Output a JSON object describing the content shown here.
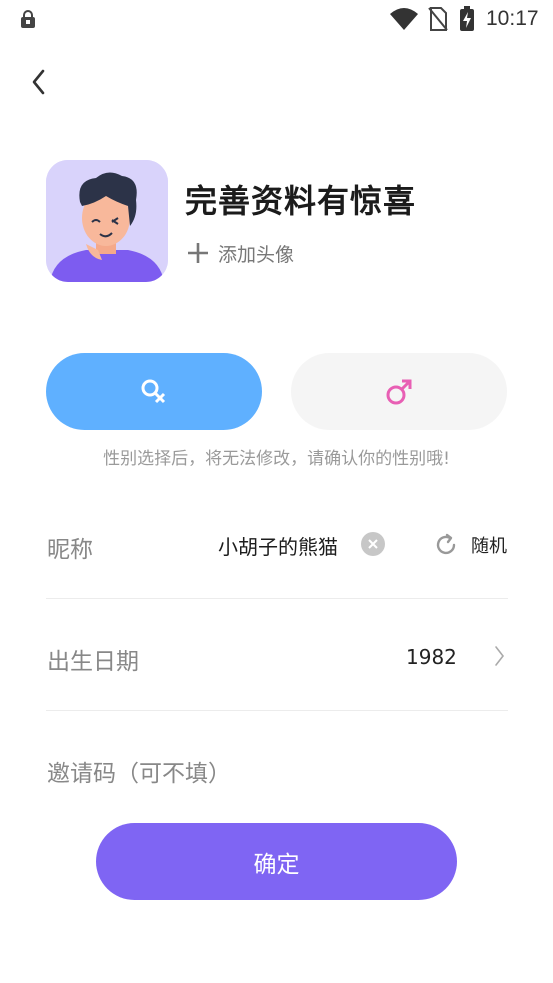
{
  "status_bar": {
    "time": "10:17",
    "icons": [
      "lock-icon",
      "wifi-icon",
      "no-sim-icon",
      "battery-charging-icon"
    ]
  },
  "nav": {
    "back_icon": "chevron-left-icon"
  },
  "profile": {
    "title": "完善资料有惊喜",
    "add_avatar_label": "添加头像",
    "add_avatar_icon": "plus-icon"
  },
  "gender": {
    "female_icon": "female-symbol-icon",
    "male_icon": "male-symbol-icon",
    "selected": "female",
    "hint": "性别选择后，将无法修改，请确认你的性别哦!"
  },
  "form": {
    "nickname": {
      "label": "昵称",
      "value": "小胡子的熊猫",
      "clear_icon": "clear-icon",
      "random_icon": "refresh-icon",
      "random_label": "随机"
    },
    "birthday": {
      "label": "出生日期",
      "value": "1982",
      "chevron_icon": "chevron-right-icon"
    },
    "invite_code": {
      "placeholder": "邀请码（可不填）"
    }
  },
  "actions": {
    "confirm_label": "确定"
  },
  "colors": {
    "accent_purple": "#7f65f3",
    "female_blue": "#5fb0ff",
    "male_pink": "#e85fb4",
    "avatar_bg": "#d9d3fb"
  }
}
